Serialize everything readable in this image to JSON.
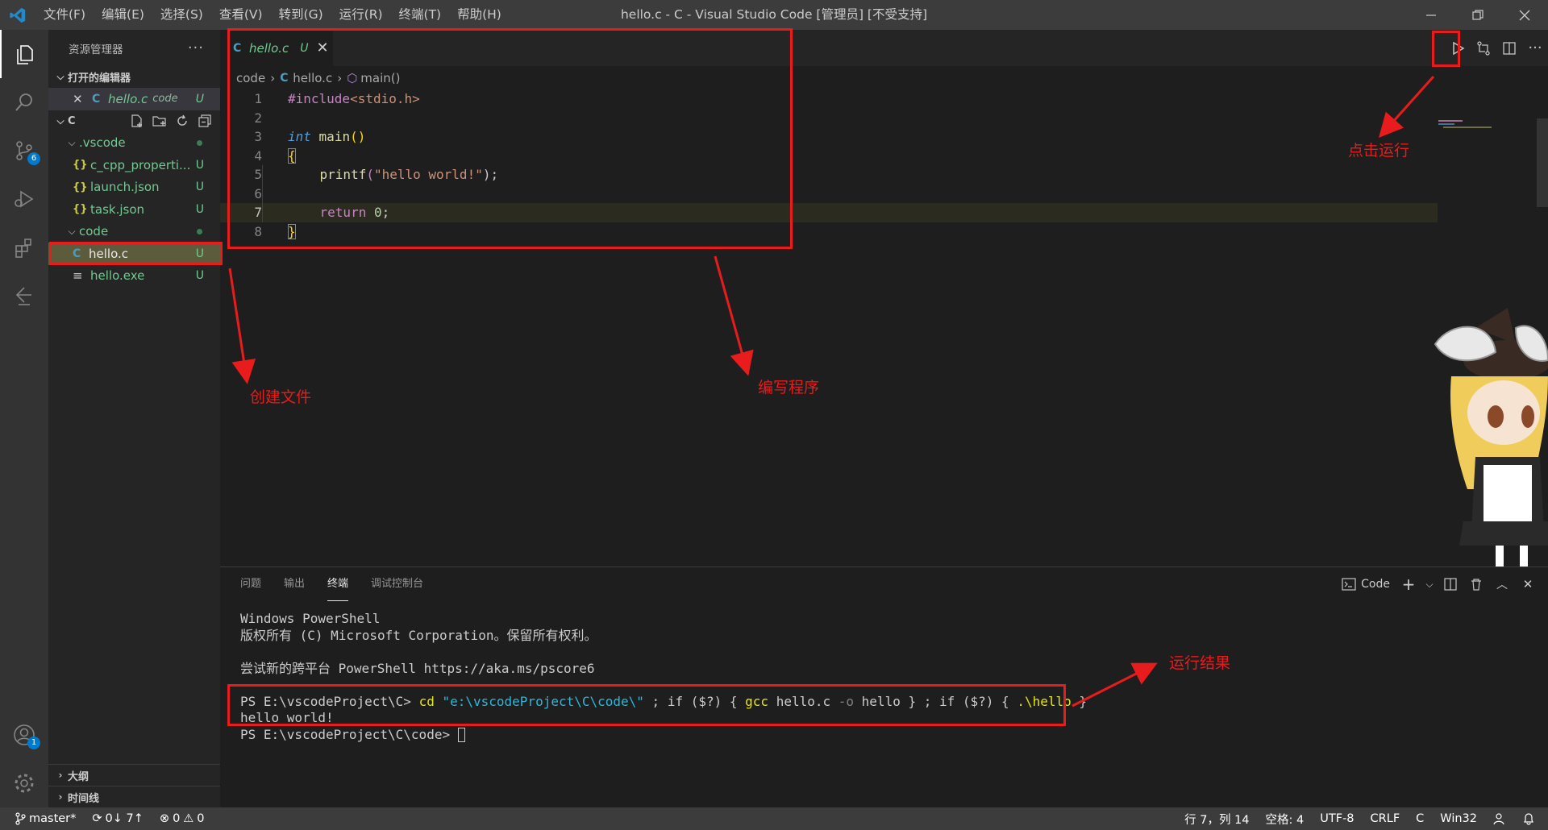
{
  "titlebar": {
    "menus": [
      "文件(F)",
      "编辑(E)",
      "选择(S)",
      "查看(V)",
      "转到(G)",
      "运行(R)",
      "终端(T)",
      "帮助(H)"
    ],
    "title": "hello.c - C - Visual Studio Code [管理员] [不受支持]"
  },
  "activitybar": {
    "scm_badge": "6",
    "account_badge": "1"
  },
  "sidebar": {
    "title": "资源管理器",
    "open_editors_label": "打开的编辑器",
    "open_editor": {
      "name": "hello.c",
      "folder": "code",
      "status": "U"
    },
    "root_label": "C",
    "tree": [
      {
        "name": ".vscode",
        "type": "folder"
      },
      {
        "name": "c_cpp_properti...",
        "type": "json",
        "status": "U"
      },
      {
        "name": "launch.json",
        "type": "json",
        "status": "U"
      },
      {
        "name": "task.json",
        "type": "json",
        "status": "U"
      },
      {
        "name": "code",
        "type": "folder"
      },
      {
        "name": "hello.c",
        "type": "c",
        "status": "U"
      },
      {
        "name": "hello.exe",
        "type": "exe",
        "status": "U"
      }
    ],
    "outline_label": "大纲",
    "timeline_label": "时间线"
  },
  "editor": {
    "tab": {
      "name": "hello.c",
      "status": "U"
    },
    "breadcrumb": [
      "code",
      "hello.c",
      "main()"
    ],
    "line_numbers": [
      "1",
      "2",
      "3",
      "4",
      "5",
      "6",
      "7",
      "8"
    ],
    "code": {
      "l1_directive": "#include",
      "l1_header": "<stdio.h>",
      "l3_type": "int",
      "l3_func": "main",
      "l3_parens": "()",
      "l4": "{",
      "l5_func": "printf",
      "l5_open": "(",
      "l5_str": "\"hello world!\"",
      "l5_close": ");",
      "l7_kw": "return",
      "l7_num": "0",
      "l7_end": ";",
      "l8": "}"
    }
  },
  "panel": {
    "tabs": [
      "问题",
      "输出",
      "终端",
      "调试控制台"
    ],
    "active_tab": "终端",
    "terminal_name": "Code",
    "terminal": {
      "l1": "Windows PowerShell",
      "l2": "版权所有 (C) Microsoft Corporation。保留所有权利。",
      "l4": "尝试新的跨平台 PowerShell https://aka.ms/pscore6",
      "prompt1": "PS E:\\vscodeProject\\C> ",
      "cmd_cd": "cd",
      "cmd_path": "\"e:\\vscodeProject\\C\\code\\\"",
      "cmd_sep1": " ; if ($?) { ",
      "cmd_gcc": "gcc",
      "cmd_gcc_args1": " hello.c ",
      "cmd_flag": "-o",
      "cmd_gcc_args2": " hello } ; if ($?) { ",
      "cmd_run": ".\\hello",
      "cmd_end": " }",
      "output": "hello world!",
      "prompt2": "PS E:\\vscodeProject\\C\\code> "
    }
  },
  "statusbar": {
    "branch": "master*",
    "sync": "0↓ 7↑",
    "errors": "0",
    "warnings": "0",
    "position": "行 7，列 14",
    "spaces": "空格: 4",
    "encoding": "UTF-8",
    "eol": "CRLF",
    "language": "C",
    "platform": "Win32"
  },
  "annotations": {
    "create_file": "创建文件",
    "write_program": "编写程序",
    "click_run": "点击运行",
    "run_result": "运行结果",
    "color": "#e81c1c"
  }
}
